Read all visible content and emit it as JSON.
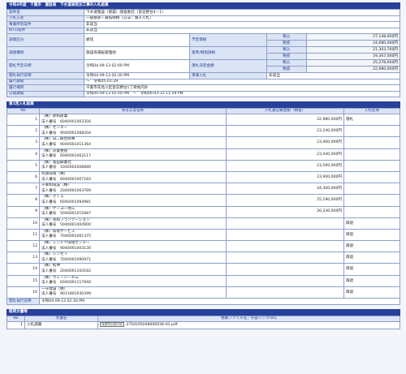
{
  "header": {
    "title": "令和4年度　千葉市　建設局　下水道局発注工事の入札結果"
  },
  "info": {
    "case_name_label": "案件名",
    "case_name": "下水道施設（管渠）調査委託（習志野台4－1）",
    "method_label": "入札方式",
    "method": "一般競争・最低価格（方法：電子入札）",
    "manager_label": "事業所等案件",
    "manager": "非該当",
    "wto_label": "WTO案件",
    "wto": "非該当",
    "category_label": "調達区分",
    "category": "委託",
    "type_label": "調達種目",
    "type": "施設等運転管理他",
    "planned_price_label": "予定価格",
    "base_price_label": "基準/制限価格",
    "min_price_label": "落札決定金額",
    "price_tax_in": "税込",
    "price_tax_ex": "税抜",
    "planned_in": "27,148,000円",
    "planned_ex": "24,680,000円",
    "base_in": "21,303,700円",
    "base_ex": "19,367,000円",
    "min_in": "25,278,000円",
    "min_ex": "22,980,000円",
    "open_date_label": "開札予定日時",
    "open_date": "令和04-09-13 02:00 PM",
    "bid_date_label": "開札執行日時",
    "bid_date": "令和04-09-13 02:30 PM",
    "unit_label": "単価入札",
    "unit": "非該当",
    "period_label": "履行期間",
    "period": "～　令和05-01-29",
    "place_label": "履行場所",
    "place": "千葉市花見川区習志野台1丁目地内外",
    "public_label": "公開期間",
    "public": "令和04-09-13 05:00 PM　～　令和06-03-31 11:59 PM"
  },
  "bids": {
    "section_title": "第1回入札結果",
    "col_no": "No",
    "col_name": "商号又は名称",
    "col_amount": "入札書記載金額（税抜）",
    "col_result": "入札結果",
    "corp_label": "法人番号",
    "rows": [
      {
        "no": "1",
        "name": "（株）昇和産業",
        "corp": "6040001003356",
        "amount": "22,980,000円",
        "result": "落札"
      },
      {
        "no": "2",
        "name": "（株）センエー",
        "corp": "9040001008204",
        "amount": "23,240,000円",
        "result": ""
      },
      {
        "no": "3",
        "name": "（株）山二総合商事",
        "corp": "9040001011364",
        "amount": "23,400,000円",
        "result": ""
      },
      {
        "no": "4",
        "name": "（株）京葉整管",
        "corp": "6040001002117",
        "amount": "23,440,000円",
        "result": ""
      },
      {
        "no": "5",
        "name": "（株）長田興業社",
        "corp": "1040002008680",
        "amount": "23,500,000円",
        "result": ""
      },
      {
        "no": "6",
        "name": "丸徳環境（株）",
        "corp": "6040001007183",
        "amount": "23,900,000円",
        "result": ""
      },
      {
        "no": "7",
        "name": "千幸和環設（株）",
        "corp": "2040001003789",
        "amount": "24,300,000円",
        "result": ""
      },
      {
        "no": "8",
        "name": "（株）さくら",
        "corp": "6040001094981",
        "amount": "25,190,000円",
        "result": ""
      },
      {
        "no": "9",
        "name": "（株）ケーヨー地工",
        "corp": "5040001015687",
        "amount": "26,330,000円",
        "result": ""
      },
      {
        "no": "10",
        "name": "（株）晃和プランテーション",
        "corp": "5040001004900",
        "amount": "",
        "result": "辞退"
      },
      {
        "no": "11",
        "name": "（株）環境サービス",
        "corp": "7040001001375",
        "amount": "",
        "result": "辞退"
      },
      {
        "no": "12",
        "name": "（株）シンドウ環境センター",
        "corp": "9040001003130",
        "amount": "",
        "result": "辞退"
      },
      {
        "no": "13",
        "name": "（株）シンセイ",
        "corp": "7040001090971",
        "amount": "",
        "result": "辞退"
      },
      {
        "no": "14",
        "name": "（株）松仲",
        "corp": "2040001104182",
        "amount": "",
        "result": "辞退"
      },
      {
        "no": "15",
        "name": "（株）ヴィーシーエム",
        "corp": "6040001117940",
        "amount": "",
        "result": "辞退"
      },
      {
        "no": "16",
        "name": "一守建設（株）",
        "corp": "9011801030399",
        "amount": "",
        "result": "辞退"
      }
    ],
    "footer_label": "開札執行日時",
    "footer_value": "令和04-09-13 02:30 PM"
  },
  "docs": {
    "section_title": "既明文書等",
    "col_no": "No",
    "col_doc": "文書名",
    "col_file": "格納ファイル名／外部リンクURL",
    "rows": [
      {
        "no": "1",
        "doc": "入札調書",
        "button": "ダウンロード",
        "file": "2750205048000036-01.pdf"
      }
    ]
  }
}
